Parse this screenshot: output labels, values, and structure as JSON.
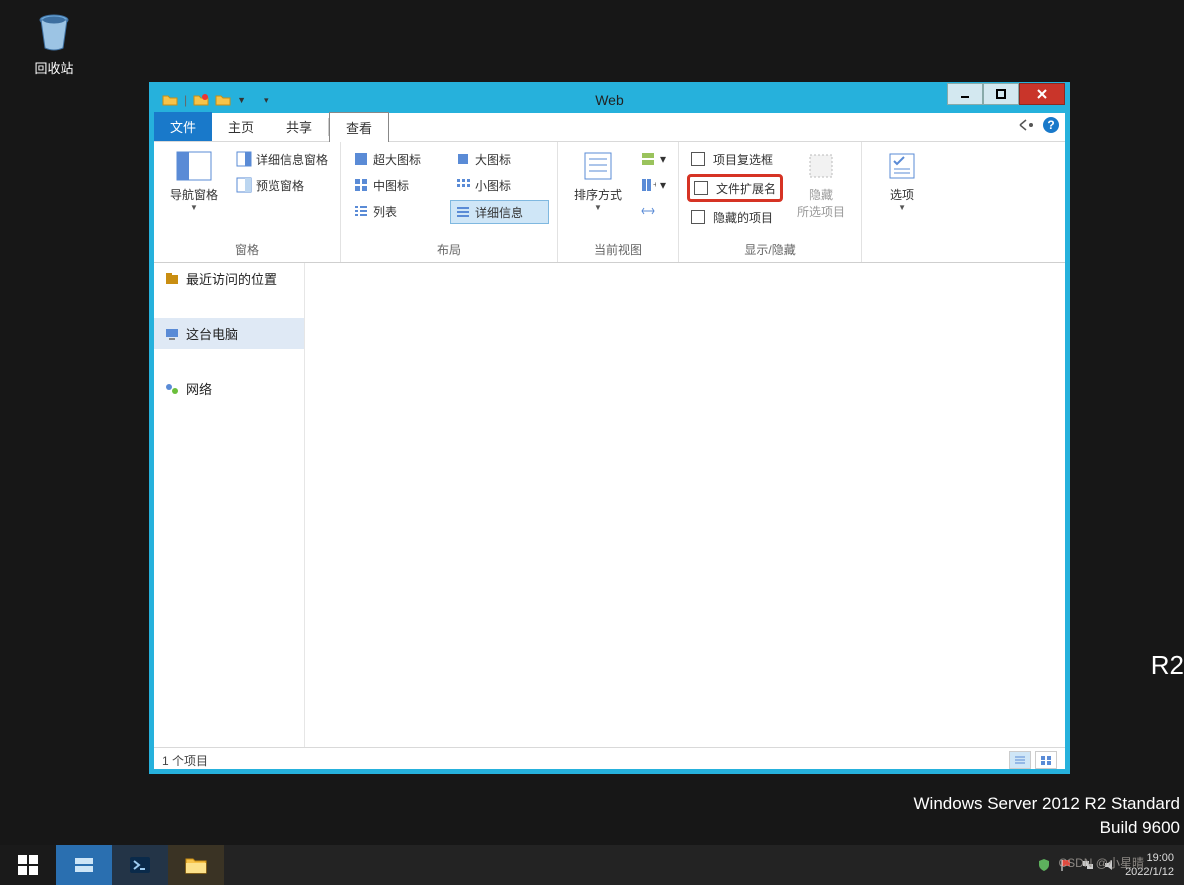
{
  "desktop": {
    "recycle_bin": "回收站",
    "r2": "R2",
    "os_line1": "Windows Server 2012 R2 Standard",
    "os_line2": "Build 9600"
  },
  "window": {
    "title": "Web",
    "tabs": {
      "file": "文件",
      "home": "主页",
      "share": "共享",
      "view": "查看"
    }
  },
  "ribbon": {
    "panes": {
      "label": "窗格",
      "nav_pane": "导航窗格",
      "detail_pane": "详细信息窗格",
      "preview_pane": "预览窗格"
    },
    "layout": {
      "label": "布局",
      "extra_large": "超大图标",
      "large": "大图标",
      "medium": "中图标",
      "small": "小图标",
      "list": "列表",
      "details": "详细信息"
    },
    "current_view": {
      "label": "当前视图",
      "sort_by": "排序方式"
    },
    "show_hide": {
      "label": "显示/隐藏",
      "item_checkboxes": "项目复选框",
      "file_ext": "文件扩展名",
      "hidden_items": "隐藏的项目",
      "hide": "隐藏",
      "selected_items": "所选项目"
    },
    "options": {
      "label": "选项"
    }
  },
  "nav": {
    "recent": "最近访问的位置",
    "this_pc": "这台电脑",
    "network": "网络"
  },
  "status": {
    "items": "1 个项目"
  },
  "taskbar": {
    "time": "19:00",
    "date": "2022/1/12"
  },
  "watermark": "CSDN @小星晴"
}
